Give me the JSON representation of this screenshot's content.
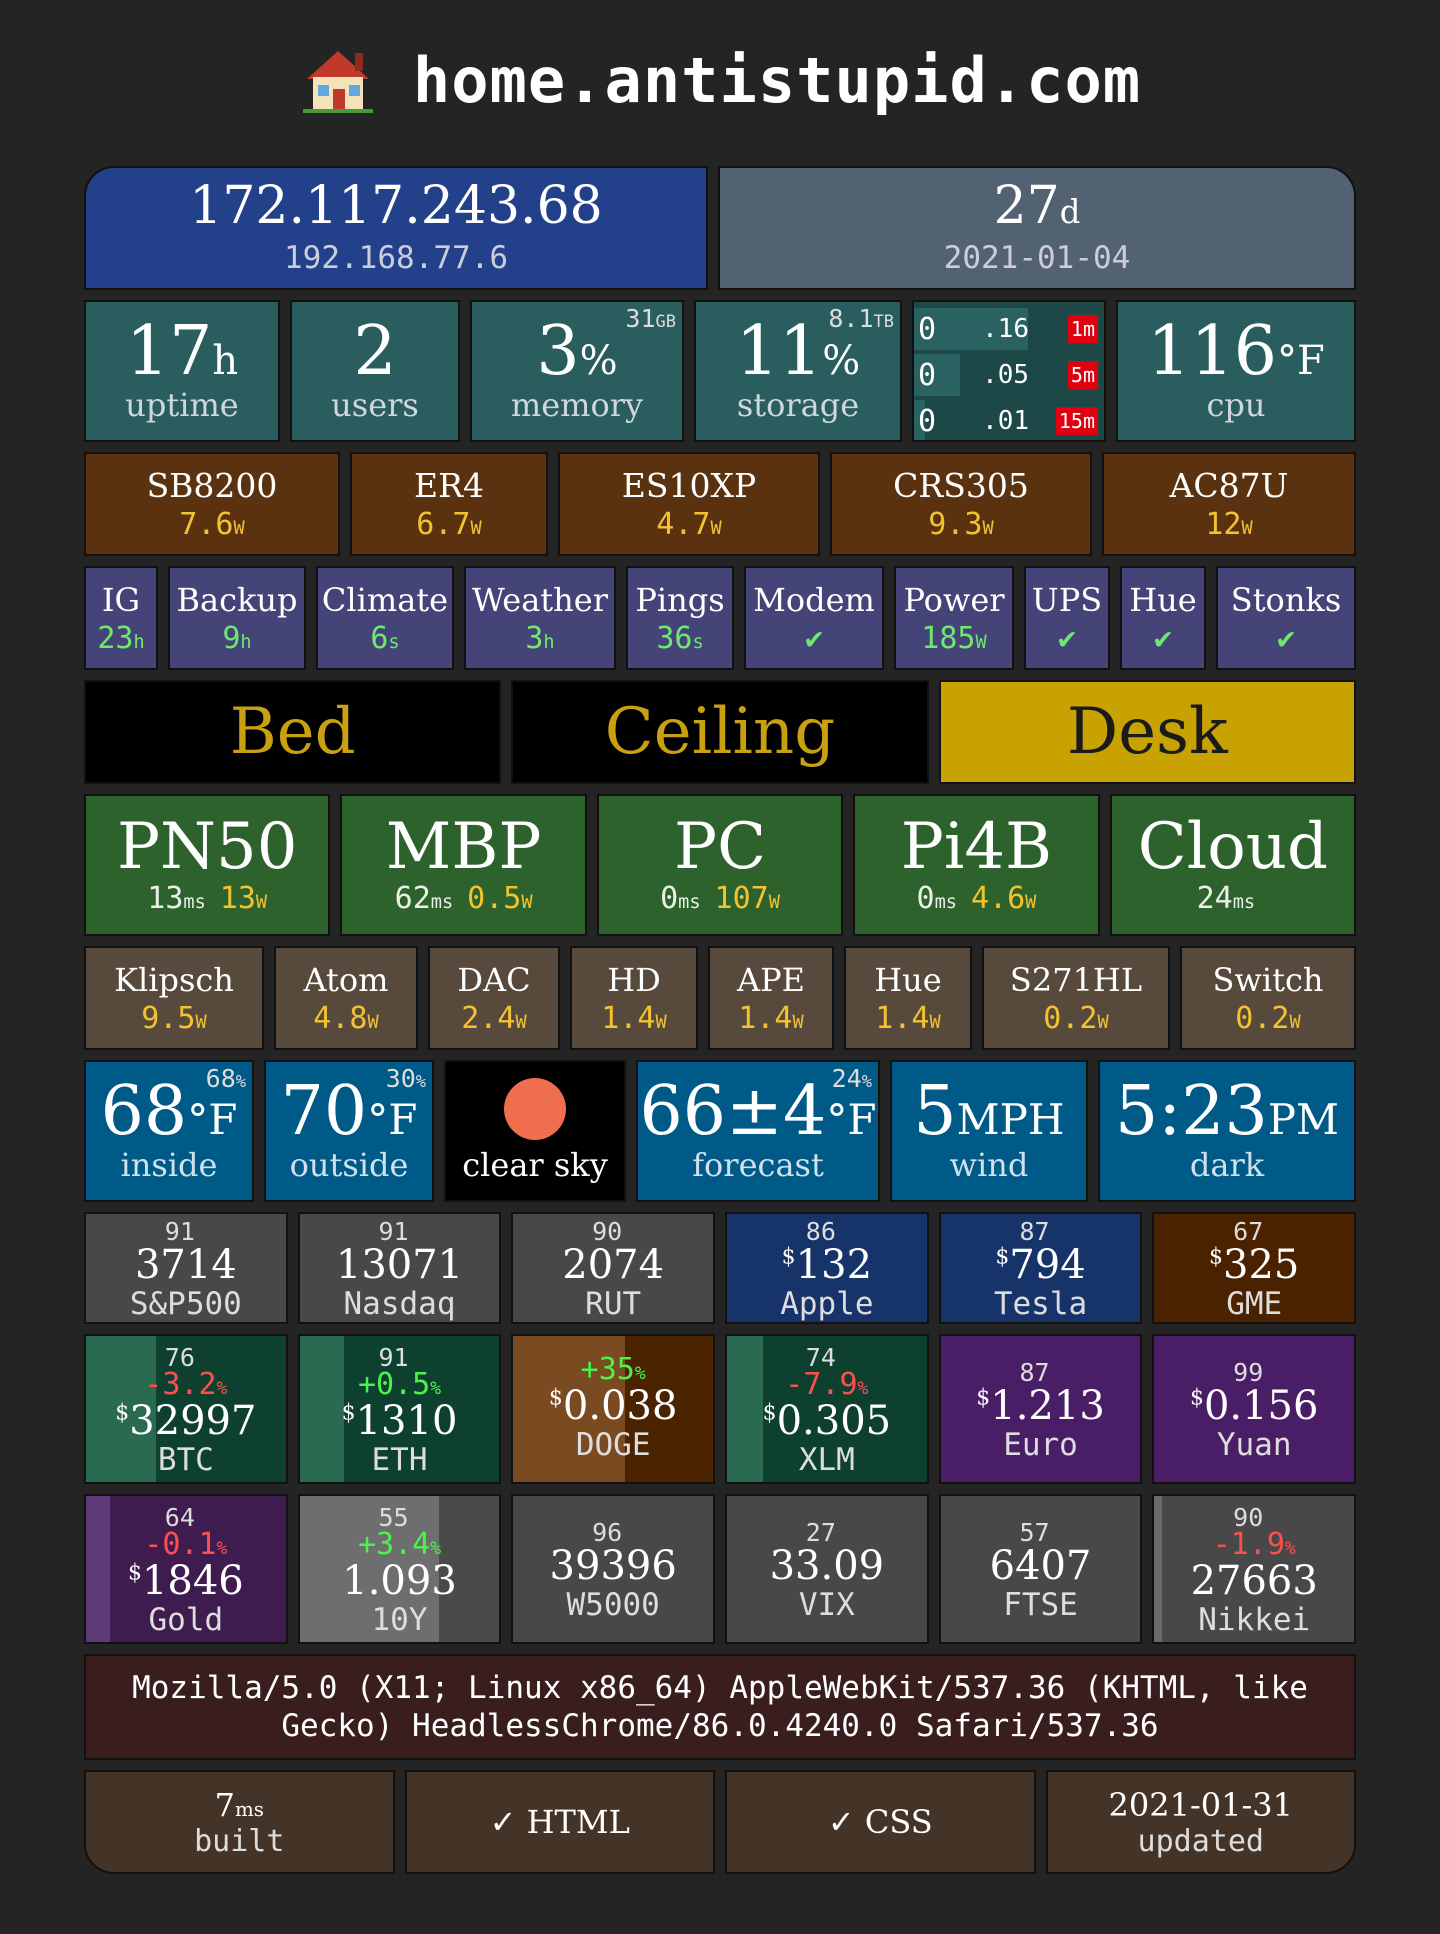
{
  "header": {
    "title": "home.antistupid.com"
  },
  "network": {
    "public_ip": "172.117.243.68",
    "local_ip": "192.168.77.6",
    "age_value": "27",
    "age_unit": "d",
    "date": "2021-01-04"
  },
  "stats": {
    "uptime": {
      "value": "17",
      "unit": "h",
      "label": "uptime"
    },
    "users": {
      "value": "2",
      "label": "users"
    },
    "memory": {
      "value": "3",
      "unit": "%",
      "label": "memory",
      "total": "31",
      "total_unit": "GB",
      "fraction": 0.03
    },
    "storage": {
      "value": "11",
      "unit": "%",
      "label": "storage",
      "total": "8.1",
      "total_unit": "TB",
      "fraction": 0.11
    },
    "load": [
      {
        "int": "0",
        "dec": ".16",
        "tag": "1m",
        "level": 0.6
      },
      {
        "int": "0",
        "dec": ".05",
        "tag": "5m",
        "level": 0.24
      },
      {
        "int": "0",
        "dec": ".01",
        "tag": "15m",
        "level": 0.06
      }
    ],
    "cpu": {
      "value": "116",
      "unit": "°F",
      "label": "cpu"
    }
  },
  "network_devices": [
    {
      "name": "SB8200",
      "watts": "7.6",
      "unit": "W"
    },
    {
      "name": "ER4",
      "watts": "6.7",
      "unit": "W"
    },
    {
      "name": "ES10XP",
      "watts": "4.7",
      "unit": "W"
    },
    {
      "name": "CRS305",
      "watts": "9.3",
      "unit": "W"
    },
    {
      "name": "AC87U",
      "watts": "12",
      "unit": "W"
    }
  ],
  "services": [
    {
      "name": "IG",
      "value": "23",
      "unit": "h"
    },
    {
      "name": "Backup",
      "value": "9",
      "unit": "h"
    },
    {
      "name": "Climate",
      "value": "6",
      "unit": "s"
    },
    {
      "name": "Weather",
      "value": "3",
      "unit": "h"
    },
    {
      "name": "Pings",
      "value": "36",
      "unit": "s"
    },
    {
      "name": "Modem",
      "value": "✔",
      "unit": ""
    },
    {
      "name": "Power",
      "value": "185",
      "unit": "W"
    },
    {
      "name": "UPS",
      "value": "✔",
      "unit": ""
    },
    {
      "name": "Hue",
      "value": "✔",
      "unit": ""
    },
    {
      "name": "Stonks",
      "value": "✔",
      "unit": ""
    }
  ],
  "lights": [
    {
      "name": "Bed",
      "on": false
    },
    {
      "name": "Ceiling",
      "on": false
    },
    {
      "name": "Desk",
      "on": true
    }
  ],
  "hosts": [
    {
      "name": "PN50",
      "ping": "13",
      "ping_unit": "ms",
      "watts": "13",
      "watt_unit": "W"
    },
    {
      "name": "MBP",
      "ping": "62",
      "ping_unit": "ms",
      "watts": "0.5",
      "watt_unit": "W"
    },
    {
      "name": "PC",
      "ping": "0",
      "ping_unit": "ms",
      "watts": "107",
      "watt_unit": "W"
    },
    {
      "name": "Pi4B",
      "ping": "0",
      "ping_unit": "ms",
      "watts": "4.6",
      "watt_unit": "W"
    },
    {
      "name": "Cloud",
      "ping": "24",
      "ping_unit": "ms",
      "watts": "",
      "watt_unit": ""
    }
  ],
  "appliances": [
    {
      "name": "Klipsch",
      "watts": "9.5",
      "unit": "W"
    },
    {
      "name": "Atom",
      "watts": "4.8",
      "unit": "W"
    },
    {
      "name": "DAC",
      "watts": "2.4",
      "unit": "W"
    },
    {
      "name": "HD",
      "watts": "1.4",
      "unit": "W"
    },
    {
      "name": "APE",
      "watts": "1.4",
      "unit": "W"
    },
    {
      "name": "Hue",
      "watts": "1.4",
      "unit": "W"
    },
    {
      "name": "S271HL",
      "watts": "0.2",
      "unit": "W"
    },
    {
      "name": "Switch",
      "watts": "0.2",
      "unit": "W"
    }
  ],
  "weather": {
    "inside": {
      "value": "68",
      "unit": "°F",
      "label": "inside",
      "humidity": "68",
      "humidity_unit": "%"
    },
    "outside": {
      "value": "70",
      "unit": "°F",
      "label": "outside",
      "humidity": "30",
      "humidity_unit": "%"
    },
    "sky": {
      "label": "clear sky",
      "icon": "sun-icon",
      "color": "#f06e50"
    },
    "forecast": {
      "value": "66±4",
      "unit": "°F",
      "label": "forecast",
      "humidity": "24",
      "humidity_unit": "%"
    },
    "wind": {
      "value": "5",
      "unit": "MPH",
      "label": "wind"
    },
    "sunset": {
      "value": "5:23",
      "unit": "PM",
      "label": "dark"
    }
  },
  "markets_row1": [
    {
      "name": "S&P500",
      "value": "3714",
      "dollar": false,
      "score": "91",
      "bg": "#484848"
    },
    {
      "name": "Nasdaq",
      "value": "13071",
      "dollar": false,
      "score": "91",
      "bg": "#484848"
    },
    {
      "name": "RUT",
      "value": "2074",
      "dollar": false,
      "score": "90",
      "bg": "#484848"
    },
    {
      "name": "Apple",
      "value": "132",
      "dollar": true,
      "score": "86",
      "bg": "#16336a"
    },
    {
      "name": "Tesla",
      "value": "794",
      "dollar": true,
      "score": "87",
      "bg": "#16336a"
    },
    {
      "name": "GME",
      "value": "325",
      "dollar": true,
      "score": "67",
      "bg": "#4a2200"
    }
  ],
  "markets_row2": [
    {
      "name": "BTC",
      "value": "32997",
      "dollar": true,
      "score": "76",
      "change": "-3.2",
      "change_unit": "%",
      "bg": "#0e4030",
      "bar": "#2a6a50",
      "fill": 0.35
    },
    {
      "name": "ETH",
      "value": "1310",
      "dollar": true,
      "score": "91",
      "change": "+0.5",
      "change_unit": "%",
      "bg": "#0e4030",
      "bar": "#2a6a50",
      "fill": 0.22
    },
    {
      "name": "DOGE",
      "value": "0.038",
      "dollar": true,
      "score": "",
      "change": "+35",
      "change_unit": "%",
      "bg": "#4a2400",
      "bar": "#7a4a20",
      "fill": 0.56
    },
    {
      "name": "XLM",
      "value": "0.305",
      "dollar": true,
      "score": "74",
      "change": "-7.9",
      "change_unit": "%",
      "bg": "#0e4030",
      "bar": "#2a6a50",
      "fill": 0.18
    },
    {
      "name": "Euro",
      "value": "1.213",
      "dollar": true,
      "score": "87",
      "change": "",
      "change_unit": "",
      "bg": "#4a1e66",
      "bar": "#4a1e66",
      "fill": 0
    },
    {
      "name": "Yuan",
      "value": "0.156",
      "dollar": true,
      "score": "99",
      "change": "",
      "change_unit": "",
      "bg": "#4a1e66",
      "bar": "#4a1e66",
      "fill": 0
    }
  ],
  "markets_row3": [
    {
      "name": "Gold",
      "value": "1846",
      "dollar": true,
      "score": "64",
      "change": "-0.1",
      "change_unit": "%",
      "bg": "#3e1c50",
      "bar": "#5e3a78",
      "fill": 0.12
    },
    {
      "name": "10Y",
      "value": "1.093",
      "dollar": false,
      "score": "55",
      "change": "+3.4",
      "change_unit": "%",
      "bg": "#4a4a4a",
      "bar": "#6e6e6e",
      "fill": 0.7
    },
    {
      "name": "W5000",
      "value": "39396",
      "dollar": false,
      "score": "96",
      "change": "",
      "change_unit": "",
      "bg": "#484848",
      "bar": "#484848",
      "fill": 0
    },
    {
      "name": "VIX",
      "value": "33.09",
      "dollar": false,
      "score": "27",
      "change": "",
      "change_unit": "",
      "bg": "#484848",
      "bar": "#484848",
      "fill": 0
    },
    {
      "name": "FTSE",
      "value": "6407",
      "dollar": false,
      "score": "57",
      "change": "",
      "change_unit": "",
      "bg": "#484848",
      "bar": "#484848",
      "fill": 0
    },
    {
      "name": "Nikkei",
      "value": "27663",
      "dollar": false,
      "score": "90",
      "change": "-1.9",
      "change_unit": "%",
      "bg": "#484848",
      "bar": "#6a6a6a",
      "fill": 0.04
    }
  ],
  "user_agent": "Mozilla/5.0 (X11; Linux x86_64) AppleWebKit/537.36 (KHTML, like Gecko) HeadlessChrome/86.0.4240.0 Safari/537.36",
  "footer": {
    "built_value": "7",
    "built_unit": "ms",
    "built_label": "built",
    "html_label": "✓ HTML",
    "css_label": "✓ CSS",
    "updated_value": "2021-01-31",
    "updated_label": "updated"
  },
  "colors": {
    "header_blue": "#22418a",
    "header_gray": "#536273",
    "stat_teal": "#2a5e5e",
    "watt_yellow": "#f2c230",
    "ok_green": "#6ee86e",
    "down_red": "#ff4e4e",
    "up_green": "#4cf24c"
  }
}
